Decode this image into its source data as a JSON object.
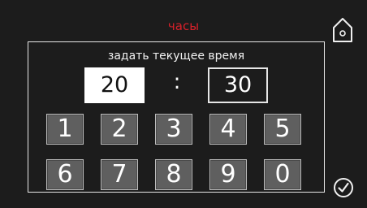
{
  "header": {
    "title": "часы"
  },
  "panel": {
    "subtitle": "задать текущее время",
    "hours_value": "20",
    "separator": ":",
    "minutes_value": "30"
  },
  "keypad": {
    "keys": [
      "1",
      "2",
      "3",
      "4",
      "5",
      "6",
      "7",
      "8",
      "9",
      "0"
    ]
  },
  "icons": {
    "home": "home-icon",
    "confirm": "check-circle-icon"
  },
  "colors": {
    "background": "#1c1c1c",
    "title": "#d8202a",
    "key_fill": "#5f5f5f",
    "key_border": "#bdbdbd",
    "active_field": "#ffffff"
  }
}
